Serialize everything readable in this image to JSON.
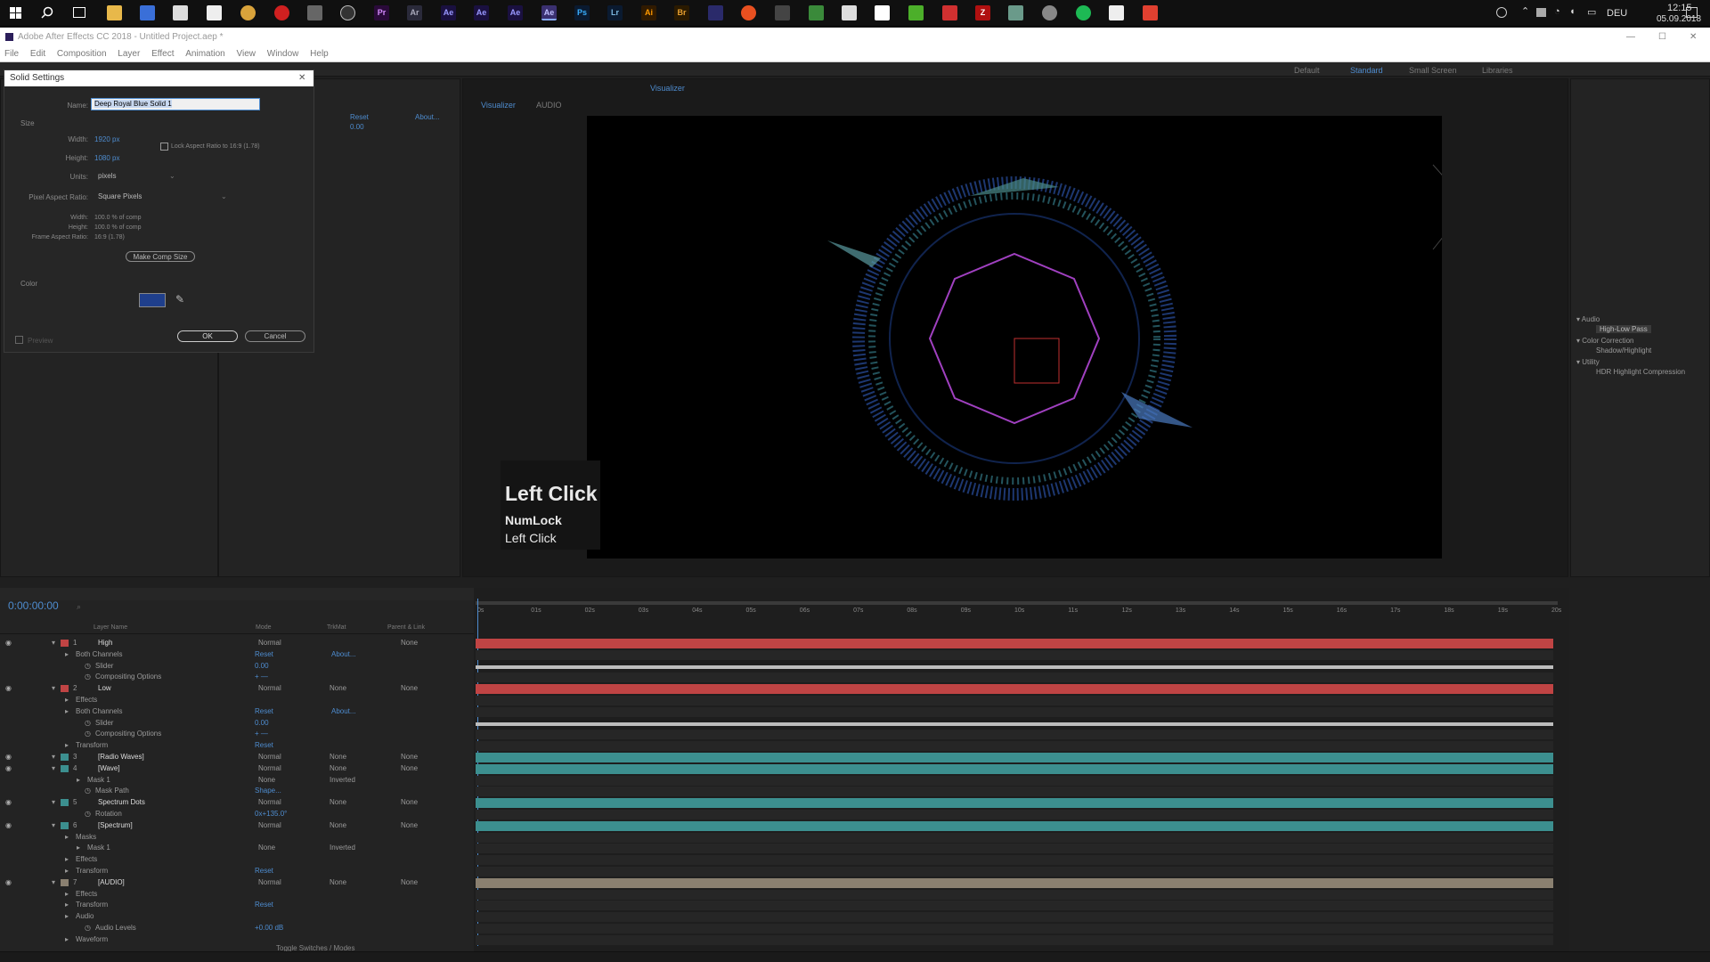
{
  "taskbar": {
    "app_icons": [
      "Pr",
      "Ar",
      "Ae",
      "Ae",
      "Ae",
      "Ae",
      "Ps",
      "Lr",
      "Ai",
      "Br"
    ],
    "lang": "DEU",
    "time": "12:15",
    "date": "05.09.2018"
  },
  "window": {
    "title": "Adobe After Effects CC 2018 - Untitled Project.aep *"
  },
  "menu": [
    "File",
    "Edit",
    "Composition",
    "Layer",
    "Effect",
    "Animation",
    "View",
    "Window",
    "Help"
  ],
  "workspaces": [
    "Default",
    "Standard",
    "Small Screen",
    "Libraries"
  ],
  "viewer": {
    "tab": "Visualizer",
    "breadcrumb": [
      "Visualizer",
      "AUDIO"
    ]
  },
  "key_overlay": {
    "main": "Left Click",
    "line2": "NumLock",
    "line3": "Left Click"
  },
  "dialog": {
    "title": "Solid Settings",
    "name_label": "Name:",
    "name_value": "Deep Royal Blue Solid 1",
    "size_label": "Size",
    "width_label": "Width:",
    "width_value": "1920 px",
    "height_label": "Height:",
    "height_value": "1080 px",
    "lock_label": "Lock Aspect Ratio to 16:9 (1.78)",
    "units_label": "Units:",
    "units_value": "pixels",
    "par_label": "Pixel Aspect Ratio:",
    "par_value": "Square Pixels",
    "info_width_label": "Width:",
    "info_width": "100.0 % of comp",
    "info_height_label": "Height:",
    "info_height": "100.0 % of comp",
    "info_far_label": "Frame Aspect Ratio:",
    "info_far": "16:9 (1.78)",
    "make_comp_size": "Make Comp Size",
    "color_label": "Color",
    "color_hex": "#1f3f8c",
    "preview_label": "Preview",
    "ok": "OK",
    "cancel": "Cancel"
  },
  "effect_controls": {
    "reset": "Reset",
    "about": "About...",
    "value": "0.00"
  },
  "effects_presets": {
    "groups": [
      {
        "name": "Audio",
        "items": [
          "High-Low Pass"
        ]
      },
      {
        "name": "Color Correction",
        "items": [
          "Shadow/Highlight"
        ]
      },
      {
        "name": "Utility",
        "items": [
          "HDR Highlight Compression"
        ]
      }
    ]
  },
  "timeline": {
    "timecode": "0:00:00:00",
    "headers": {
      "layer_name": "Layer Name",
      "mode": "Mode",
      "trkmat": "TrkMat",
      "parent": "Parent & Link"
    },
    "ruler": [
      "0s",
      "01s",
      "02s",
      "03s",
      "04s",
      "05s",
      "06s",
      "07s",
      "08s",
      "09s",
      "10s",
      "11s",
      "12s",
      "13s",
      "14s",
      "15s",
      "16s",
      "17s",
      "18s",
      "19s",
      "20s"
    ],
    "rows": [
      {
        "num": "1",
        "name": "High",
        "mode": "Normal",
        "trk": "",
        "parent": "None",
        "kind": "layer",
        "color": "#c04444"
      },
      {
        "num": "",
        "name": "Both Channels",
        "link1": "Reset",
        "link2": "About...",
        "kind": "effect"
      },
      {
        "num": "",
        "name": "Slider",
        "value": "0.00",
        "kind": "prop"
      },
      {
        "num": "",
        "name": "Compositing Options",
        "value": "+ —",
        "kind": "prop"
      },
      {
        "num": "2",
        "name": "Low",
        "mode": "Normal",
        "trk": "None",
        "parent": "None",
        "kind": "layer",
        "color": "#c04444"
      },
      {
        "num": "",
        "name": "Effects",
        "kind": "group"
      },
      {
        "num": "",
        "name": "Both Channels",
        "link1": "Reset",
        "link2": "About...",
        "kind": "effect"
      },
      {
        "num": "",
        "name": "Slider",
        "value": "0.00",
        "kind": "prop"
      },
      {
        "num": "",
        "name": "Compositing Options",
        "value": "+ —",
        "kind": "prop"
      },
      {
        "num": "",
        "name": "Transform",
        "link1": "Reset",
        "kind": "group"
      },
      {
        "num": "3",
        "name": "[Radio Waves]",
        "mode": "Normal",
        "trk": "None",
        "parent": "None",
        "kind": "layer",
        "color": "#3c8f8f"
      },
      {
        "num": "4",
        "name": "[Wave]",
        "mode": "Normal",
        "trk": "None",
        "parent": "None",
        "kind": "layer",
        "color": "#3c8f8f"
      },
      {
        "num": "",
        "name": "Mask 1",
        "mode": "None",
        "trk": "Inverted",
        "kind": "mask"
      },
      {
        "num": "",
        "name": "Mask Path",
        "link1": "Shape...",
        "kind": "prop"
      },
      {
        "num": "5",
        "name": "Spectrum Dots",
        "mode": "Normal",
        "trk": "None",
        "parent": "None",
        "kind": "layer",
        "color": "#3c8f8f"
      },
      {
        "num": "",
        "name": "Rotation",
        "value": "0x+135.0°",
        "kind": "prop"
      },
      {
        "num": "6",
        "name": "[Spectrum]",
        "mode": "Normal",
        "trk": "None",
        "parent": "None",
        "kind": "layer",
        "color": "#3c8f8f"
      },
      {
        "num": "",
        "name": "Masks",
        "kind": "group"
      },
      {
        "num": "",
        "name": "Mask 1",
        "mode": "None",
        "trk": "Inverted",
        "kind": "mask"
      },
      {
        "num": "",
        "name": "Effects",
        "kind": "group"
      },
      {
        "num": "",
        "name": "Transform",
        "link1": "Reset",
        "kind": "group"
      },
      {
        "num": "7",
        "name": "[AUDIO]",
        "mode": "Normal",
        "trk": "None",
        "parent": "None",
        "kind": "layer",
        "color": "#8a8070"
      },
      {
        "num": "",
        "name": "Effects",
        "kind": "group"
      },
      {
        "num": "",
        "name": "Transform",
        "link1": "Reset",
        "kind": "group"
      },
      {
        "num": "",
        "name": "Audio",
        "kind": "group"
      },
      {
        "num": "",
        "name": "Audio Levels",
        "value": "+0.00 dB",
        "kind": "prop"
      },
      {
        "num": "",
        "name": "Waveform",
        "kind": "group"
      }
    ],
    "toggle": "Toggle Switches / Modes"
  }
}
